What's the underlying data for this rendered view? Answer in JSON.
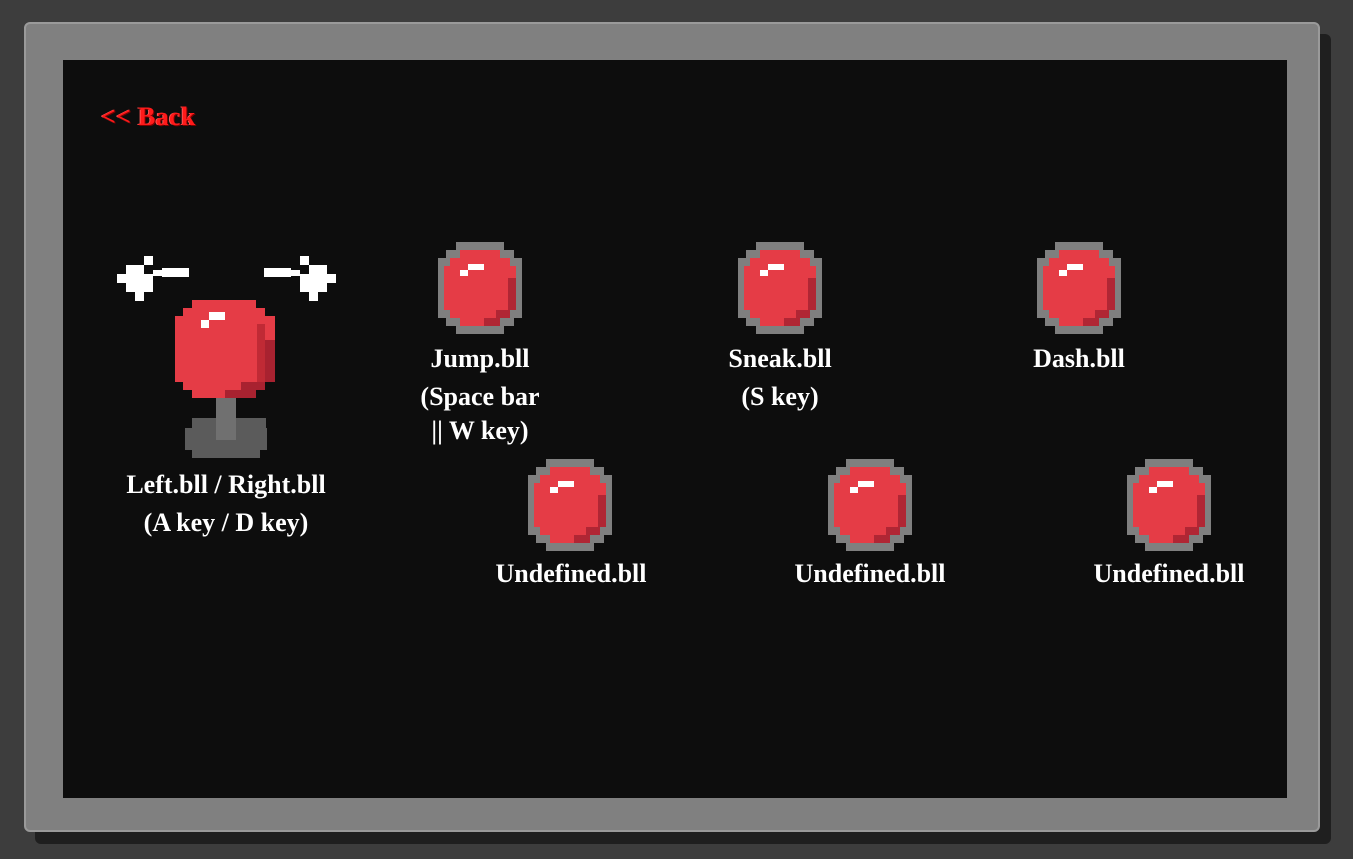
{
  "back": {
    "label": "<< Back"
  },
  "joystick": {
    "label_line1": "Left.bll / Right.bll",
    "label_line2": "(A key / D key)",
    "left_icon": "arrow-left-icon",
    "right_icon": "arrow-right-icon",
    "icon": "joystick-icon"
  },
  "buttons": [
    {
      "id": "jump",
      "lines": [
        "Jump.bll",
        "(Space bar",
        "|| W key)"
      ]
    },
    {
      "id": "sneak",
      "lines": [
        "Sneak.bll",
        "(S key)"
      ]
    },
    {
      "id": "dash",
      "lines": [
        "Dash.bll"
      ]
    },
    {
      "id": "undefined-1",
      "lines": [
        "Undefined.bll"
      ]
    },
    {
      "id": "undefined-2",
      "lines": [
        "Undefined.bll"
      ]
    },
    {
      "id": "undefined-3",
      "lines": [
        "Undefined.bll"
      ]
    }
  ],
  "colors": {
    "background": "#3d3d3d",
    "frame": "#808080",
    "screen": "#0d0d0d",
    "button_red": "#e53c46",
    "button_ring": "#7f7f7f",
    "back_link": "#ff1a1a"
  }
}
